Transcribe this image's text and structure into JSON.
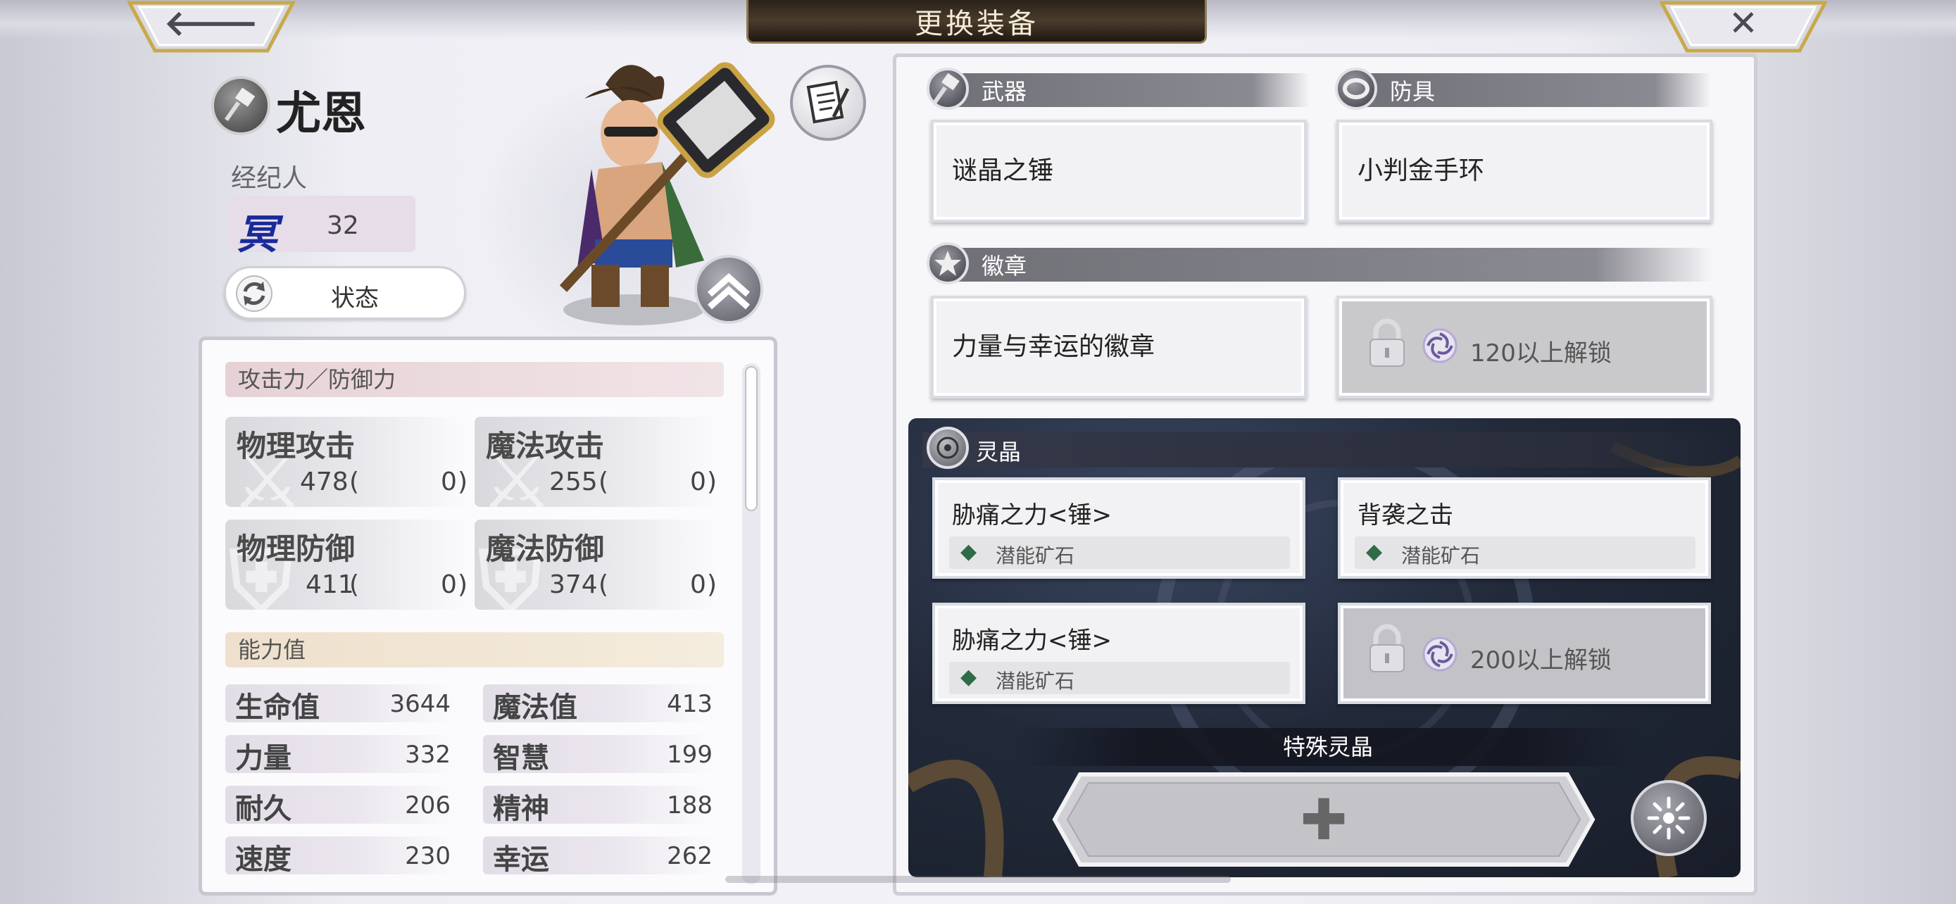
{
  "header": {
    "title": "更换装备",
    "back_glyph": "🡐",
    "close_glyph": "✕"
  },
  "character": {
    "name": "尤恩",
    "agent_label": "经纪人",
    "agent_glyph": "冥",
    "agent_level": "32",
    "status_button": "状态"
  },
  "stats": {
    "attack_defense_header": "攻击力／防御力",
    "combat": [
      {
        "name": "物理攻击",
        "value": "478",
        "bonus": "0"
      },
      {
        "name": "魔法攻击",
        "value": "255",
        "bonus": "0"
      },
      {
        "name": "物理防御",
        "value": "411",
        "bonus": "0"
      },
      {
        "name": "魔法防御",
        "value": "374",
        "bonus": "0"
      }
    ],
    "ability_header": "能力值",
    "abilities": [
      {
        "name": "生命值",
        "value": "3644"
      },
      {
        "name": "魔法值",
        "value": "413"
      },
      {
        "name": "力量",
        "value": "332"
      },
      {
        "name": "智慧",
        "value": "199"
      },
      {
        "name": "耐久",
        "value": "206"
      },
      {
        "name": "精神",
        "value": "188"
      },
      {
        "name": "速度",
        "value": "230"
      },
      {
        "name": "幸运",
        "value": "262"
      }
    ]
  },
  "equipment": {
    "weapon_label": "武器",
    "weapon": "谜晶之锤",
    "armor_label": "防具",
    "armor": "小判金手环",
    "badge_label": "徽章",
    "badge": "力量与幸运的徽章",
    "badge_locked": "120以上解锁"
  },
  "crystals": {
    "label": "灵晶",
    "slots": [
      {
        "name": "胁痛之力<锤>",
        "sub": "潜能矿石"
      },
      {
        "name": "背袭之击",
        "sub": "潜能矿石"
      },
      {
        "name": "胁痛之力<锤>",
        "sub": "潜能矿石"
      }
    ],
    "locked": "200以上解锁",
    "special_label": "特殊灵晶",
    "add_glyph": "✚"
  }
}
